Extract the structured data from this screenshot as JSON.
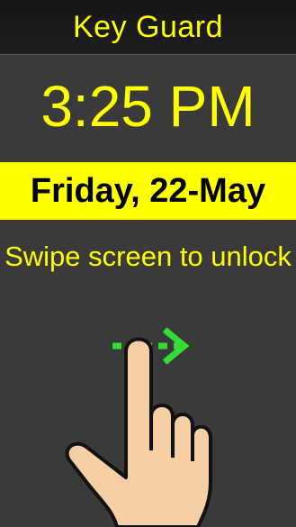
{
  "app": {
    "title": "Key Guard"
  },
  "lock": {
    "time": "3:25 PM",
    "date": "Friday, 22-May",
    "instruction": "Swipe screen to unlock"
  },
  "colors": {
    "background": "#3a3a3a",
    "title_bar": "#1a1a1a",
    "accent_text": "#ffff00",
    "date_band": "#ffff00",
    "arrow": "#33dd33",
    "hand_fill": "#f6cfa4",
    "hand_outline": "#111111"
  },
  "icons": {
    "gesture": "swipe-right-hand-icon",
    "arrow": "arrow-right-icon"
  }
}
